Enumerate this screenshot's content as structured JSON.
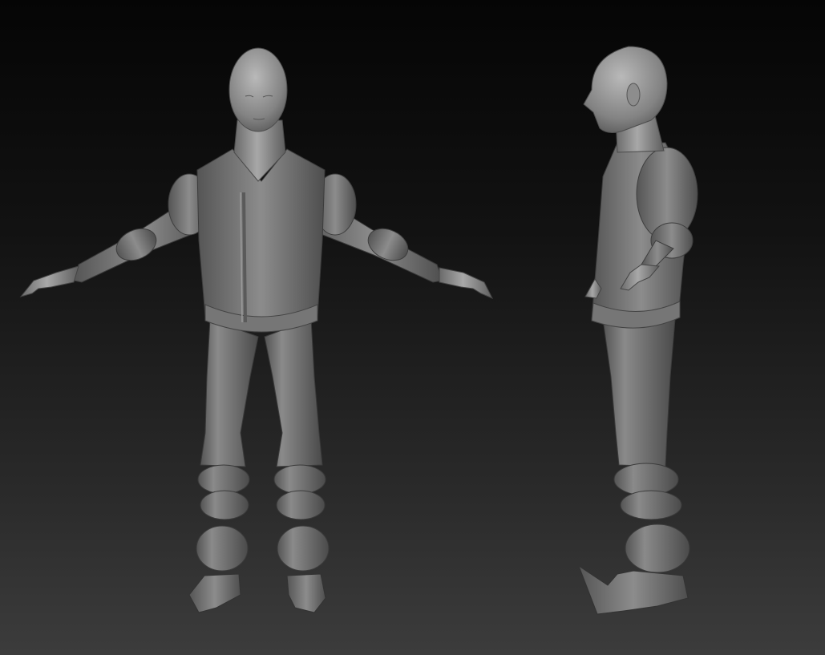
{
  "scene": {
    "background_top": "#050505",
    "background_bottom": "#3c3c3c",
    "material_color": "#8a8a8a",
    "models": [
      {
        "name": "front-view",
        "pose": "A-pose"
      },
      {
        "name": "side-view",
        "pose": "A-pose"
      }
    ]
  }
}
